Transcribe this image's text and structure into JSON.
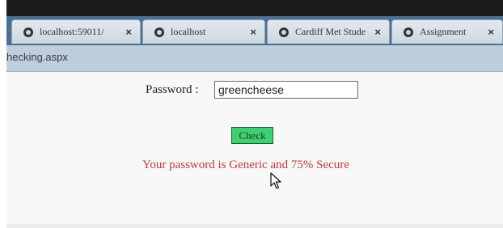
{
  "browser": {
    "tabs": [
      {
        "label": "localhost:59011/",
        "close": "×"
      },
      {
        "label": "localhost",
        "close": "×"
      },
      {
        "label": "Cardiff Met Stude",
        "close": "×"
      },
      {
        "label": "Assignment",
        "close": "×"
      }
    ],
    "page_name": "hecking.aspx"
  },
  "form": {
    "password_label": "Password :",
    "password_value": "greencheese",
    "check_button": "Check",
    "result_text": "Your password is Generic and 75% Secure"
  },
  "colors": {
    "tabbar": "#4d6f92",
    "button_green": "#3fcf72",
    "result_red": "#c23a3a"
  }
}
